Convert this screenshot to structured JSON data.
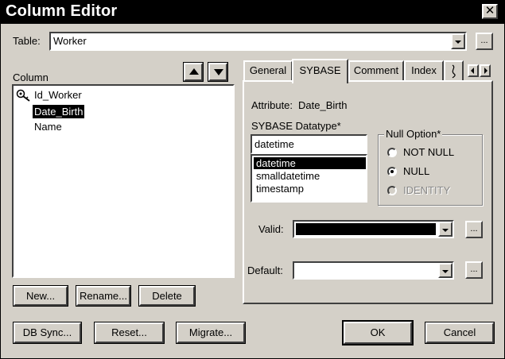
{
  "window": {
    "title": "Column Editor",
    "close_glyph": "✕"
  },
  "table": {
    "label": "Table:",
    "value": "Worker",
    "more_label": "..."
  },
  "column": {
    "label": "Column",
    "items": [
      {
        "label": "Id_Worker",
        "icon": "key-icon",
        "selected": false
      },
      {
        "label": "Date_Birth",
        "selected": true
      },
      {
        "label": "Name",
        "selected": false
      }
    ],
    "buttons": {
      "new": "New...",
      "rename": "Rename...",
      "delete": "Delete"
    }
  },
  "tabs": [
    {
      "label": "General",
      "active": false
    },
    {
      "label": "SYBASE",
      "active": true
    },
    {
      "label": "Comment",
      "active": false
    },
    {
      "label": "Index",
      "active": false
    }
  ],
  "sybase": {
    "attribute_label": "Attribute:",
    "attribute_value": "Date_Birth",
    "datatype_label": "SYBASE Datatype*",
    "datatype_value": "datetime",
    "datatype_options": [
      {
        "label": "datetime",
        "selected": true
      },
      {
        "label": "smalldatetime",
        "selected": false
      },
      {
        "label": "timestamp",
        "selected": false
      }
    ],
    "null_option": {
      "label": "Null Option*",
      "options": [
        {
          "label": "NOT NULL",
          "checked": false,
          "disabled": false
        },
        {
          "label": "NULL",
          "checked": true,
          "disabled": false
        },
        {
          "label": "IDENTITY",
          "checked": false,
          "disabled": true
        }
      ]
    },
    "valid_label": "Valid:",
    "valid_value": "",
    "default_label": "Default:",
    "default_value": "",
    "more_label": "..."
  },
  "footer": {
    "db_sync": "DB Sync...",
    "reset": "Reset...",
    "migrate": "Migrate...",
    "ok": "OK",
    "cancel": "Cancel"
  }
}
